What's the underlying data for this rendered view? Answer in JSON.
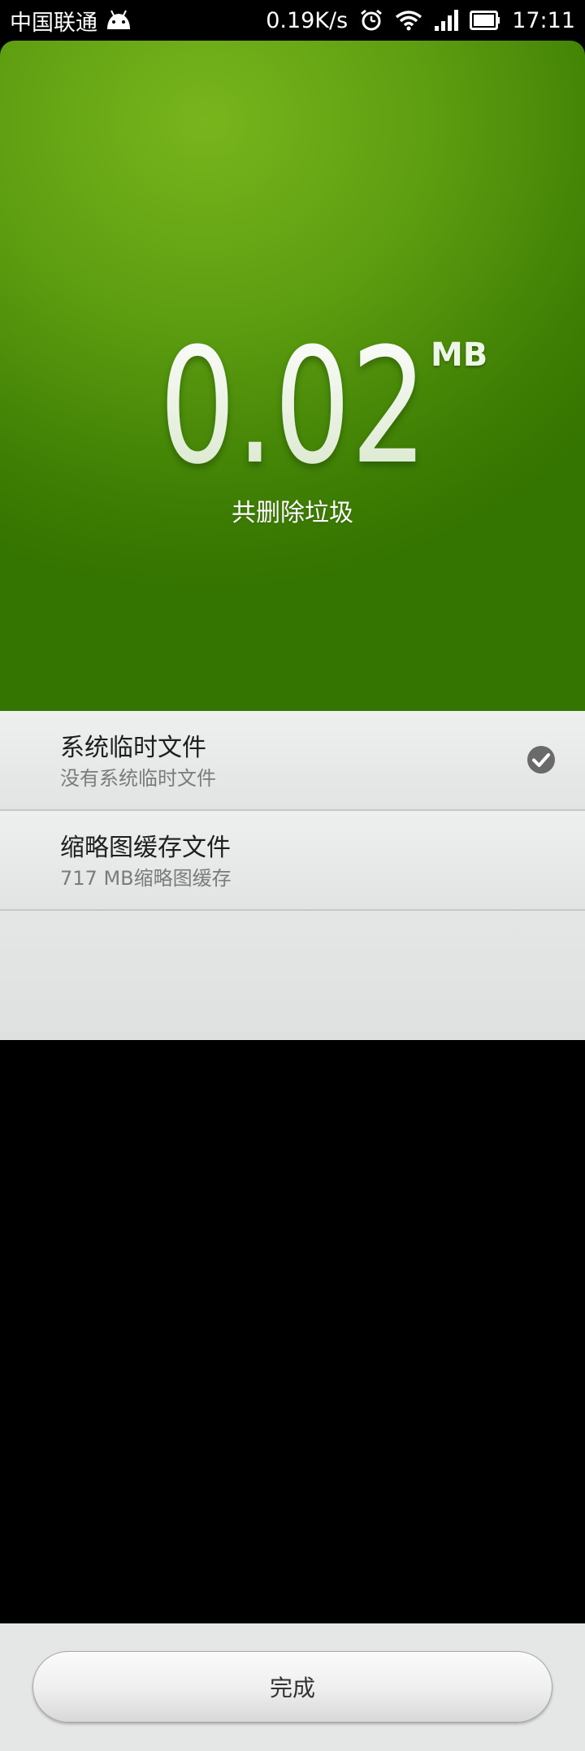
{
  "status_bar": {
    "carrier": "中国联通",
    "net_speed": "0.19K/s",
    "time": "17:11",
    "icons": [
      "android-icon",
      "alarm-icon",
      "wifi-icon",
      "signal-icon",
      "battery-icon"
    ]
  },
  "result": {
    "amount": "0.02",
    "unit": "MB",
    "caption": "共删除垃圾",
    "accent_color": "#5c9c10"
  },
  "items": [
    {
      "title": "系统临时文件",
      "subtitle": "没有系统临时文件",
      "status": "check-icon"
    },
    {
      "title": "缩略图缓存文件",
      "subtitle": "717 MB缩略图缓存"
    }
  ],
  "footer": {
    "done_label": "完成"
  }
}
